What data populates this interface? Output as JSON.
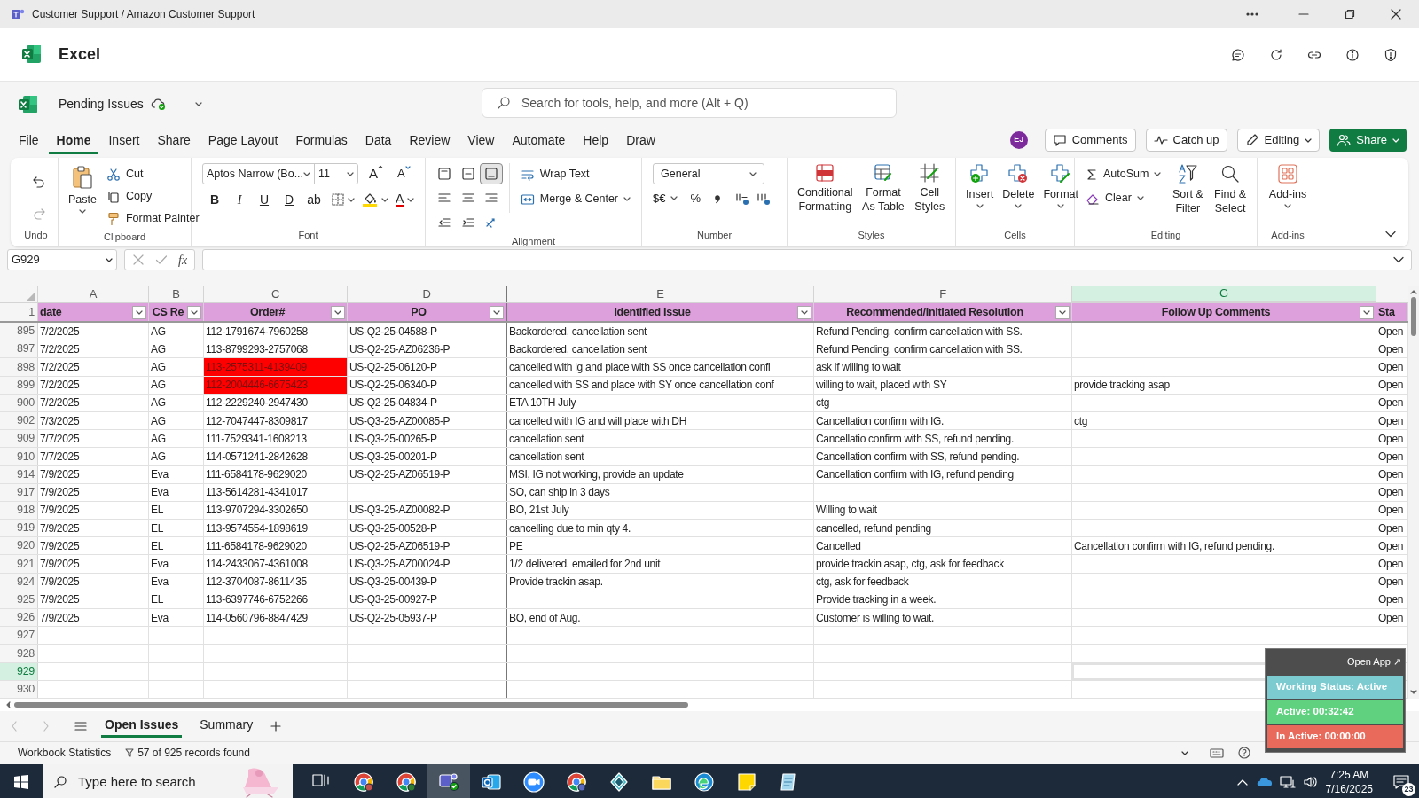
{
  "window": {
    "title": "Customer Support / Amazon Customer Support"
  },
  "app": {
    "name": "Excel"
  },
  "document": {
    "name": "Pending Issues"
  },
  "search": {
    "placeholder": "Search for tools, help, and more (Alt + Q)"
  },
  "menu_tabs": [
    {
      "label": "File",
      "selected": false
    },
    {
      "label": "Home",
      "selected": true
    },
    {
      "label": "Insert",
      "selected": false
    },
    {
      "label": "Share",
      "selected": false
    },
    {
      "label": "Page Layout",
      "selected": false
    },
    {
      "label": "Formulas",
      "selected": false
    },
    {
      "label": "Data",
      "selected": false
    },
    {
      "label": "Review",
      "selected": false
    },
    {
      "label": "View",
      "selected": false
    },
    {
      "label": "Automate",
      "selected": false
    },
    {
      "label": "Help",
      "selected": false
    },
    {
      "label": "Draw",
      "selected": false
    }
  ],
  "user": {
    "initials": "EJ"
  },
  "header_buttons": [
    "Comments",
    "Catch up",
    "Editing",
    "Share"
  ],
  "ribbon": [
    {
      "kind": "undo",
      "label": "Undo"
    },
    {
      "kind": "clipboard",
      "label": "Clipboard",
      "big": "Paste",
      "small": [
        "Cut",
        "Copy",
        "Format Painter"
      ]
    },
    {
      "kind": "font",
      "label": "Font",
      "font_name": "Aptos Narrow (Bo...",
      "font_size": "11",
      "grow": "A",
      "shrink": "A",
      "styles": [
        "B",
        "I",
        "U",
        "D",
        "ab"
      ],
      "font_color": "A"
    },
    {
      "kind": "alignment",
      "label": "Alignment",
      "align_buttons": [
        {
          "selected": false
        },
        {
          "selected": false
        },
        {
          "selected": true
        }
      ],
      "small": [
        "Wrap Text",
        "Merge & Center"
      ]
    },
    {
      "kind": "number",
      "label": "Number",
      "format": "General",
      "symbols": [
        "$€",
        "%"
      ]
    },
    {
      "kind": "styles",
      "label": "Styles",
      "big": [
        "Conditional Formatting",
        "Format As Table",
        "Cell Styles"
      ]
    },
    {
      "kind": "cells",
      "label": "Cells",
      "big": [
        "Insert",
        "Delete",
        "Format"
      ]
    },
    {
      "kind": "editing",
      "label": "Editing",
      "small": [
        "AutoSum",
        "Clear"
      ],
      "big": [
        "Sort & Filter",
        "Find & Select"
      ]
    },
    {
      "kind": "addins",
      "label": "Add-ins",
      "big": [
        "Add-ins"
      ]
    }
  ],
  "formula_bar": {
    "name_box": "G929",
    "fx": "fx"
  },
  "sheet": {
    "columns": [
      {
        "letter": "A",
        "selected": false
      },
      {
        "letter": "B",
        "selected": false
      },
      {
        "letter": "C",
        "selected": false
      },
      {
        "letter": "D",
        "selected": false
      },
      {
        "letter": "E",
        "selected": false
      },
      {
        "letter": "F",
        "selected": false
      },
      {
        "letter": "G",
        "selected": true
      }
    ],
    "header_row": {
      "row": "1",
      "cells": [
        "date",
        "CS Re",
        "Order#",
        "PO",
        "Identified Issue",
        "Recommended/Initiated Resolution",
        "Follow Up Comments",
        "Sta"
      ]
    },
    "rows": [
      {
        "row": "895",
        "selected": false,
        "cells": [
          "7/2/2025",
          "AG",
          "112-1791674-7960258",
          "US-Q2-25-04588-P",
          "Backordered, cancellation sent",
          "Refund Pending, confirm cancellation with SS.",
          "",
          "Open"
        ]
      },
      {
        "row": "897",
        "selected": false,
        "cells": [
          "7/2/2025",
          "AG",
          "113-8799293-2757068",
          "US-Q2-25-AZ06236-P",
          "Backordered, cancellation sent",
          "Refund Pending, confirm cancellation with SS.",
          "",
          "Open"
        ]
      },
      {
        "row": "898",
        "selected": false,
        "color": "#ff0000",
        "cells": [
          "7/2/2025",
          "AG",
          "113-2575311-4139409",
          "US-Q2-25-06120-P",
          "cancelled with ig and place with SS once cancellation confi",
          "ask if willing to wait",
          "",
          "Open"
        ]
      },
      {
        "row": "899",
        "selected": false,
        "color": "#ff0000",
        "cells": [
          "7/2/2025",
          "AG",
          "112-2004446-6675423",
          "US-Q2-25-06340-P",
          "cancelled with SS and place with SY once cancellation conf",
          "willing to wait, placed with SY",
          "provide tracking asap",
          "Open"
        ]
      },
      {
        "row": "900",
        "selected": false,
        "cells": [
          "7/2/2025",
          "AG",
          "112-2229240-2947430",
          "US-Q2-25-04834-P",
          "ETA 10TH July",
          "ctg",
          "",
          "Open"
        ]
      },
      {
        "row": "902",
        "selected": false,
        "cells": [
          "7/3/2025",
          "AG",
          "112-7047447-8309817",
          "US-Q3-25-AZ00085-P",
          "cancelled with IG and will place with DH",
          "Cancellation confirm with IG.",
          "ctg",
          "Open"
        ]
      },
      {
        "row": "909",
        "selected": false,
        "cells": [
          "7/7/2025",
          "AG",
          "111-7529341-1608213",
          "US-Q3-25-00265-P",
          "cancellation sent",
          "Cancellatio confirm with SS, refund pending.",
          "",
          "Open"
        ]
      },
      {
        "row": "910",
        "selected": false,
        "cells": [
          "7/7/2025",
          "AG",
          "114-0571241-2842628",
          "US-Q3-25-00201-P",
          "cancellation sent",
          "Cancellation confirm with SS, refund pending.",
          "",
          "Open"
        ]
      },
      {
        "row": "914",
        "selected": false,
        "cells": [
          "7/9/2025",
          "Eva",
          "111-6584178-9629020",
          "US-Q2-25-AZ06519-P",
          "MSI, IG not working, provide an update",
          "Cancellation confirm with IG, refund pending",
          "",
          "Open"
        ]
      },
      {
        "row": "917",
        "selected": false,
        "cells": [
          "7/9/2025",
          "Eva",
          "113-5614281-4341017",
          "",
          "SO, can ship in 3 days",
          "",
          "",
          "Open"
        ]
      },
      {
        "row": "918",
        "selected": false,
        "cells": [
          "7/9/2025",
          "EL",
          "113-9707294-3302650",
          "US-Q3-25-AZ00082-P",
          "BO, 21st July",
          "Willing to wait",
          "",
          "Open"
        ]
      },
      {
        "row": "919",
        "selected": false,
        "cells": [
          "7/9/2025",
          "EL",
          "113-9574554-1898619",
          "US-Q3-25-00528-P",
          "cancelling due to min qty 4.",
          "cancelled, refund pending",
          "",
          "Open"
        ]
      },
      {
        "row": "920",
        "selected": false,
        "cells": [
          "7/9/2025",
          "EL",
          "111-6584178-9629020",
          "US-Q2-25-AZ06519-P",
          "PE",
          "Cancelled",
          "Cancellation confirm with IG, refund pending.",
          "Open"
        ]
      },
      {
        "row": "921",
        "selected": false,
        "cells": [
          "7/9/2025",
          "Eva",
          "114-2433067-4361008",
          "US-Q3-25-AZ00024-P",
          "1/2 delivered. emailed for 2nd unit",
          "provide trackin asap, ctg, ask for feedback",
          "",
          "Open"
        ]
      },
      {
        "row": "924",
        "selected": false,
        "cells": [
          "7/9/2025",
          "Eva",
          "112-3704087-8611435",
          "US-Q3-25-00439-P",
          "Provide trackin asap.",
          "ctg, ask for feedback",
          "",
          "Open"
        ]
      },
      {
        "row": "925",
        "selected": false,
        "cells": [
          "7/9/2025",
          "EL",
          "113-6397746-6752266",
          "US-Q3-25-00927-P",
          "",
          "Provide tracking in a week.",
          "",
          "Open"
        ]
      },
      {
        "row": "926",
        "selected": false,
        "cells": [
          "7/9/2025",
          "Eva",
          "114-0560796-8847429",
          "US-Q2-25-05937-P",
          "BO, end of Aug.",
          "Customer is willing to wait.",
          "",
          "Open"
        ]
      },
      {
        "row": "927",
        "selected": false
      },
      {
        "row": "928",
        "selected": false
      },
      {
        "row": "929",
        "selected": true
      },
      {
        "row": "930",
        "selected": false
      }
    ]
  },
  "sheet_tabs": [
    {
      "label": "Open Issues",
      "selected": true
    },
    {
      "label": "Summary",
      "selected": false
    }
  ],
  "status_bar": {
    "workbook_statistics": "Workbook Statistics",
    "filter_result": "57 of 925 records found"
  },
  "tracker_widget": {
    "open_app": "Open App ↗",
    "statuses": [
      {
        "label": "Working Status: Active",
        "color": "#7ccbd0"
      },
      {
        "label": "Active: 00:32:42",
        "color": "#5fd17f"
      },
      {
        "label": "In Active: 00:00:00",
        "color": "#e9695a"
      }
    ]
  },
  "taskbar": {
    "search_placeholder": "Type here to search",
    "time": "7:25 AM",
    "date": "7/16/2025",
    "notifications": "23"
  }
}
